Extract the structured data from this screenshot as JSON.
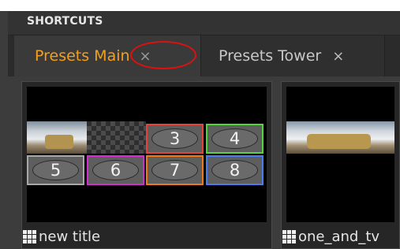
{
  "section": {
    "title": "SHORTCUTS"
  },
  "tabs": [
    {
      "label": "Presets Main",
      "close": "×",
      "active": true
    },
    {
      "label": "Presets Tower",
      "close": "×",
      "active": false
    }
  ],
  "cards": [
    {
      "caption": "new title",
      "presets": [
        {
          "number": "3",
          "color": "#e8413a"
        },
        {
          "number": "4",
          "color": "#53d63c"
        },
        {
          "number": "5",
          "color": "#a8a8a8"
        },
        {
          "number": "6",
          "color": "#d52bd4"
        },
        {
          "number": "7",
          "color": "#f07a1a"
        },
        {
          "number": "8",
          "color": "#4a7cf0"
        }
      ]
    },
    {
      "caption": "one_and_tv"
    }
  ],
  "colors": {
    "active_tab": "#f0a020",
    "annotation": "#e01010"
  }
}
